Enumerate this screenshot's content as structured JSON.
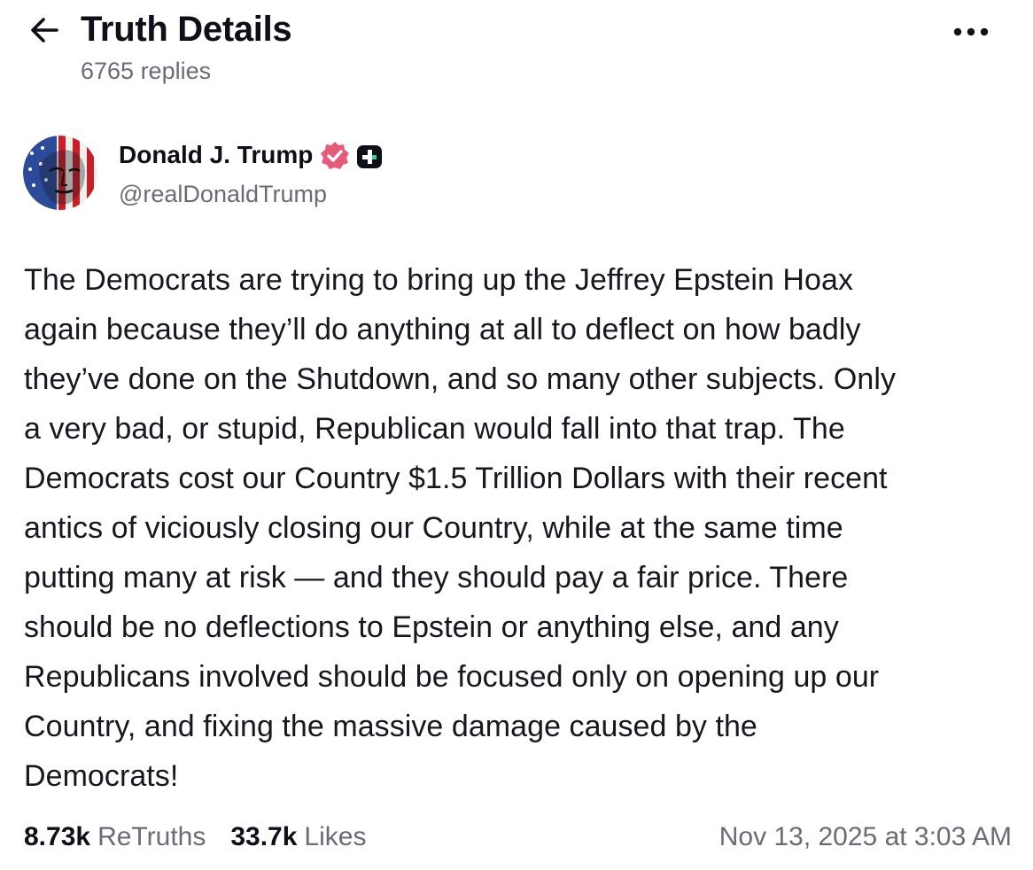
{
  "header": {
    "title": "Truth Details",
    "subtitle": "6765 replies",
    "back_icon": "arrow-left-icon",
    "more_icon": "more-horizontal-icon"
  },
  "post": {
    "author": {
      "name": "Donald J. Trump",
      "handle": "@realDonaldTrump",
      "verified_icon": "verified-badge-icon",
      "verified_color": "#e85a7a",
      "plus_badge_icon": "plus-badge-icon"
    },
    "body": "The Democrats are trying to bring up the Jeffrey Epstein Hoax\nagain because they’ll do anything at all to deflect on how badly\nthey’ve done on the Shutdown, and so many other subjects. Only\na very bad, or stupid, Republican would fall into that trap. The\nDemocrats cost our Country $1.5 Trillion Dollars with their recent\nantics of viciously closing our Country, while at the same time\nputting many at risk — and they should pay a fair price. There\nshould be no deflections to Epstein or anything else, and any\nRepublicans involved should be focused only on opening up our\nCountry, and fixing the massive damage caused by the\nDemocrats!",
    "stats": {
      "retruths_count": "8.73k",
      "retruths_label": "ReTruths",
      "likes_count": "33.7k",
      "likes_label": "Likes"
    },
    "timestamp": "Nov 13, 2025 at 3:03 AM"
  },
  "colors": {
    "text_primary": "#0f0f1a",
    "text_secondary": "#6b6b78",
    "background": "#ffffff",
    "verified": "#e85a7a"
  }
}
